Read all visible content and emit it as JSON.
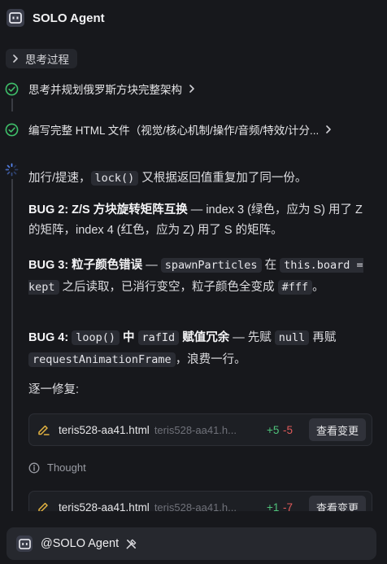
{
  "header": {
    "title": "SOLO Agent"
  },
  "thinking": {
    "label": "思考过程"
  },
  "steps": [
    {
      "label": "思考并规划俄罗斯方块完整架构"
    },
    {
      "label": "编写完整 HTML 文件（视觉/核心机制/操作/音频/特效/计分..."
    }
  ],
  "partial": {
    "top_line": "加行/提速，",
    "code": "lock()",
    "rest": "又根据返回值重复加了同一份。"
  },
  "bug2": {
    "title": "BUG 2: Z/S 方块旋转矩阵互换",
    "text": "— index 3 (绿色，应为 S) 用了 Z 的矩阵，index 4 (红色，应为 Z) 用了 S 的矩阵。"
  },
  "bug3": {
    "title": "BUG 3: 粒子颜色错误",
    "dash": "—",
    "code1": "spawnParticles",
    "t1": "在",
    "code2": "this.board = kept",
    "t2": "之后读取，已消行变空，粒子颜色全变成",
    "code3": "#fff",
    "t3": "。"
  },
  "bug4": {
    "title_pre": "BUG 4:",
    "code1": "loop()",
    "mid": "中",
    "code2": "rafId",
    "title_post": "赋值冗余",
    "t1": "— 先赋",
    "code3": "null",
    "t2": "再赋",
    "code4": "requestAnimationFrame",
    "t3": "，浪费一行。"
  },
  "fix_label": "逐一修复:",
  "file_cards": [
    {
      "name": "teris528-aa41.html",
      "path": "teris528-aa41.h...",
      "added": "+5",
      "removed": "-5",
      "button": "查看变更"
    },
    {
      "name": "teris528-aa41.html",
      "path": "teris528-aa41.h...",
      "added": "+1",
      "removed": "-7",
      "button": "查看变更"
    }
  ],
  "thought": {
    "label": "Thought"
  },
  "composer": {
    "text": "@SOLO Agent"
  }
}
